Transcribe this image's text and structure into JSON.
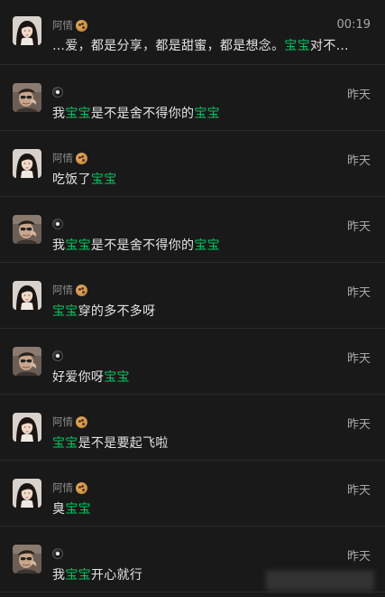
{
  "conversations": [
    {
      "type": "girl",
      "name": "阿情",
      "name_icon": "cookie-icon",
      "time": "00:19",
      "message": [
        {
          "text": "…爱，都是分享，都是甜蜜，都是想念。",
          "hl": false
        },
        {
          "text": "宝宝",
          "hl": true
        },
        {
          "text": "对不…",
          "hl": false
        }
      ]
    },
    {
      "type": "boy",
      "name": "",
      "name_icon": "eight-ball-icon",
      "time": "昨天",
      "message": [
        {
          "text": "我",
          "hl": false
        },
        {
          "text": "宝宝",
          "hl": true
        },
        {
          "text": "是不是舍不得你的",
          "hl": false
        },
        {
          "text": "宝宝",
          "hl": true
        }
      ]
    },
    {
      "type": "girl",
      "name": "阿情",
      "name_icon": "cookie-icon",
      "time": "昨天",
      "message": [
        {
          "text": "吃饭了",
          "hl": false
        },
        {
          "text": "宝宝",
          "hl": true
        }
      ]
    },
    {
      "type": "boy",
      "name": "",
      "name_icon": "eight-ball-icon",
      "time": "昨天",
      "message": [
        {
          "text": "我",
          "hl": false
        },
        {
          "text": "宝宝",
          "hl": true
        },
        {
          "text": "是不是舍不得你的",
          "hl": false
        },
        {
          "text": "宝宝",
          "hl": true
        }
      ]
    },
    {
      "type": "girl",
      "name": "阿情",
      "name_icon": "cookie-icon",
      "time": "昨天",
      "message": [
        {
          "text": "宝宝",
          "hl": true
        },
        {
          "text": "穿的多不多呀",
          "hl": false
        }
      ]
    },
    {
      "type": "boy",
      "name": "",
      "name_icon": "eight-ball-icon",
      "time": "昨天",
      "message": [
        {
          "text": "好爱你呀",
          "hl": false
        },
        {
          "text": "宝宝",
          "hl": true
        }
      ]
    },
    {
      "type": "girl",
      "name": "阿情",
      "name_icon": "cookie-icon",
      "time": "昨天",
      "message": [
        {
          "text": "宝宝",
          "hl": true
        },
        {
          "text": "是不是要起飞啦",
          "hl": false
        }
      ]
    },
    {
      "type": "girl",
      "name": "阿情",
      "name_icon": "cookie-icon",
      "time": "昨天",
      "message": [
        {
          "text": "臭",
          "hl": false
        },
        {
          "text": "宝宝",
          "hl": true
        }
      ]
    },
    {
      "type": "boy",
      "name": "",
      "name_icon": "eight-ball-icon",
      "time": "昨天",
      "message": [
        {
          "text": "我",
          "hl": false
        },
        {
          "text": "宝宝",
          "hl": true
        },
        {
          "text": "开心就行",
          "hl": false
        }
      ]
    }
  ],
  "colors": {
    "background": "#191919",
    "highlight": "#07c160",
    "time": "#a8a8a8",
    "name": "#8c8c8c"
  }
}
